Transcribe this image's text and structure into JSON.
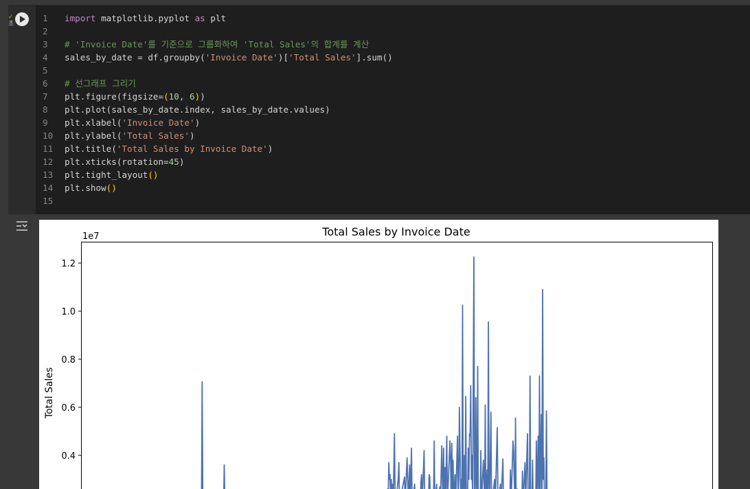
{
  "code_cell": {
    "status": "초",
    "lines": [
      {
        "n": "1",
        "html": "<span class=\"kw\">import</span> matplotlib.pyplot <span class=\"kw\">as</span> plt"
      },
      {
        "n": "2",
        "html": ""
      },
      {
        "n": "3",
        "html": "<span class=\"cm\"># 'Invoice Date'를 기준으로 그룹화하여 'Total Sales'의 합계를 계산</span>"
      },
      {
        "n": "4",
        "html": "sales_by_date = df.groupby(<span class=\"str\">'Invoice Date'</span>)[<span class=\"str\">'Total Sales'</span>].sum()"
      },
      {
        "n": "5",
        "html": ""
      },
      {
        "n": "6",
        "html": "<span class=\"cm\"># 선그래프 그리기</span>"
      },
      {
        "n": "7",
        "html": "plt.figure(figsize=<span class=\"paren\">(</span><span class=\"num\">10</span>, <span class=\"num\">6</span><span class=\"paren\">)</span>)"
      },
      {
        "n": "8",
        "html": "plt.plot(sales_by_date.index, sales_by_date.values)"
      },
      {
        "n": "9",
        "html": "plt.xlabel(<span class=\"str\">'Invoice Date'</span>)"
      },
      {
        "n": "10",
        "html": "plt.ylabel(<span class=\"str\">'Total Sales'</span>)"
      },
      {
        "n": "11",
        "html": "plt.title(<span class=\"str\">'Total Sales by Invoice Date'</span>)"
      },
      {
        "n": "12",
        "html": "plt.xticks(rotation=<span class=\"num\">45</span>)"
      },
      {
        "n": "13",
        "html": "plt.tight_layout<span class=\"paren\">()</span>"
      },
      {
        "n": "14",
        "html": "plt.show<span class=\"paren\">()</span>"
      },
      {
        "n": "15",
        "html": ""
      }
    ]
  },
  "chart_data": {
    "type": "line",
    "title": "Total Sales by Invoice Date",
    "xlabel": "",
    "ylabel": "Total Sales",
    "offset_label": "1e7",
    "ylim_visible": [
      0.24,
      1.28
    ],
    "yticks": [
      "0.4",
      "0.6",
      "0.8",
      "1.0",
      "1.2"
    ],
    "ytick_values": [
      0.4,
      0.6,
      0.8,
      1.0,
      1.2
    ],
    "color": "#4c72b0",
    "x_range": [
      0,
      1000
    ],
    "series": [
      {
        "values_scaled_1e7": [
          [
            0,
            0.2
          ],
          [
            188,
            0.2
          ],
          [
            190,
            0.2
          ],
          [
            191,
            0.706
          ],
          [
            192,
            0.2
          ],
          [
            225,
            0.2
          ],
          [
            226,
            0.36
          ],
          [
            227,
            0.2
          ],
          [
            484,
            0.2
          ],
          [
            485,
            0.26
          ],
          [
            486,
            0.2
          ],
          [
            487,
            0.37
          ],
          [
            488,
            0.3
          ],
          [
            489,
            0.32
          ],
          [
            490,
            0.2
          ],
          [
            491,
            0.3
          ],
          [
            492,
            0.2
          ],
          [
            493,
            0.28
          ],
          [
            494,
            0.2
          ],
          [
            496,
            0.49
          ],
          [
            497,
            0.25
          ],
          [
            498,
            0.2
          ],
          [
            502,
            0.3
          ],
          [
            503,
            0.37
          ],
          [
            504,
            0.2
          ],
          [
            512,
            0.31
          ],
          [
            513,
            0.2
          ],
          [
            516,
            0.39
          ],
          [
            517,
            0.3
          ],
          [
            518,
            0.2
          ],
          [
            520,
            0.36
          ],
          [
            521,
            0.2
          ],
          [
            523,
            0.43
          ],
          [
            524,
            0.2
          ],
          [
            528,
            0.28
          ],
          [
            529,
            0.2
          ],
          [
            537,
            0.2
          ],
          [
            538,
            0.29
          ],
          [
            539,
            0.32
          ],
          [
            540,
            0.2
          ],
          [
            543,
            0.42
          ],
          [
            544,
            0.2
          ],
          [
            550,
            0.2
          ],
          [
            551,
            0.32
          ],
          [
            552,
            0.31
          ],
          [
            553,
            0.2
          ],
          [
            558,
            0.2
          ],
          [
            559,
            0.46
          ],
          [
            560,
            0.2
          ],
          [
            563,
            0.28
          ],
          [
            564,
            0.2
          ],
          [
            568,
            0.27
          ],
          [
            569,
            0.2
          ],
          [
            571,
            0.44
          ],
          [
            572,
            0.3
          ],
          [
            573,
            0.2
          ],
          [
            574,
            0.43
          ],
          [
            575,
            0.2
          ],
          [
            576,
            0.35
          ],
          [
            577,
            0.2
          ],
          [
            579,
            0.48
          ],
          [
            580,
            0.2
          ],
          [
            584,
            0.46
          ],
          [
            585,
            0.38
          ],
          [
            586,
            0.2
          ],
          [
            587,
            0.45
          ],
          [
            588,
            0.2
          ],
          [
            589,
            0.38
          ],
          [
            590,
            0.2
          ],
          [
            592,
            0.32
          ],
          [
            593,
            0.2
          ],
          [
            596,
            0.48
          ],
          [
            597,
            0.2
          ],
          [
            598,
            0.31
          ],
          [
            599,
            0.6
          ],
          [
            600,
            0.42
          ],
          [
            601,
            0.25
          ],
          [
            602,
            0.3
          ],
          [
            603,
            0.2
          ],
          [
            604,
            1.025
          ],
          [
            605,
            0.2
          ],
          [
            607,
            0.4
          ],
          [
            608,
            0.2
          ],
          [
            609,
            0.645
          ],
          [
            610,
            0.2
          ],
          [
            612,
            0.2
          ],
          [
            613,
            0.43
          ],
          [
            614,
            0.3
          ],
          [
            615,
            0.49
          ],
          [
            616,
            0.48
          ],
          [
            617,
            0.69
          ],
          [
            618,
            0.3
          ],
          [
            619,
            0.4
          ],
          [
            620,
            0.2
          ],
          [
            622,
            1.225
          ],
          [
            623,
            0.2
          ],
          [
            624,
            0.2
          ],
          [
            625,
            0.64
          ],
          [
            626,
            0.3
          ],
          [
            627,
            0.2
          ],
          [
            628,
            0.77
          ],
          [
            629,
            0.2
          ],
          [
            632,
            0.2
          ],
          [
            633,
            0.42
          ],
          [
            634,
            0.2
          ],
          [
            637,
            0.38
          ],
          [
            638,
            0.29
          ],
          [
            639,
            0.2
          ],
          [
            640,
            0.61
          ],
          [
            641,
            0.2
          ],
          [
            643,
            0.34
          ],
          [
            644,
            0.2
          ],
          [
            645,
            0.955
          ],
          [
            646,
            0.3
          ],
          [
            647,
            0.2
          ],
          [
            649,
            0.58
          ],
          [
            650,
            0.2
          ],
          [
            655,
            0.3
          ],
          [
            656,
            0.2
          ],
          [
            659,
            0.515
          ],
          [
            660,
            0.25
          ],
          [
            661,
            0.2
          ],
          [
            664,
            0.28
          ],
          [
            665,
            0.2
          ],
          [
            668,
            0.385
          ],
          [
            669,
            0.2
          ],
          [
            675,
            0.2
          ],
          [
            679,
            0.2
          ],
          [
            680,
            0.34
          ],
          [
            681,
            0.2
          ],
          [
            684,
            0.46
          ],
          [
            685,
            0.42
          ],
          [
            686,
            0.3
          ],
          [
            687,
            0.2
          ],
          [
            688,
            0.555
          ],
          [
            689,
            0.2
          ],
          [
            691,
            0.26
          ],
          [
            692,
            0.2
          ],
          [
            698,
            0.2
          ],
          [
            699,
            0.335
          ],
          [
            700,
            0.2
          ],
          [
            703,
            0.37
          ],
          [
            704,
            0.2
          ],
          [
            707,
            0.49
          ],
          [
            708,
            0.2
          ],
          [
            710,
            0.2
          ],
          [
            711,
            0.73
          ],
          [
            712,
            0.2
          ],
          [
            714,
            0.2
          ],
          [
            715,
            0.38
          ],
          [
            716,
            0.2
          ],
          [
            720,
            0.2
          ],
          [
            721,
            0.46
          ],
          [
            722,
            0.2
          ],
          [
            724,
            0.48
          ],
          [
            725,
            0.2
          ],
          [
            726,
            0.73
          ],
          [
            727,
            0.2
          ],
          [
            729,
            0.57
          ],
          [
            730,
            0.2
          ],
          [
            731,
            1.09
          ],
          [
            732,
            0.3
          ],
          [
            733,
            0.39
          ],
          [
            734,
            0.2
          ],
          [
            736,
            0.2
          ],
          [
            737,
            0.585
          ],
          [
            738,
            0.2
          ],
          [
            740,
            0.2
          ]
        ]
      }
    ]
  }
}
